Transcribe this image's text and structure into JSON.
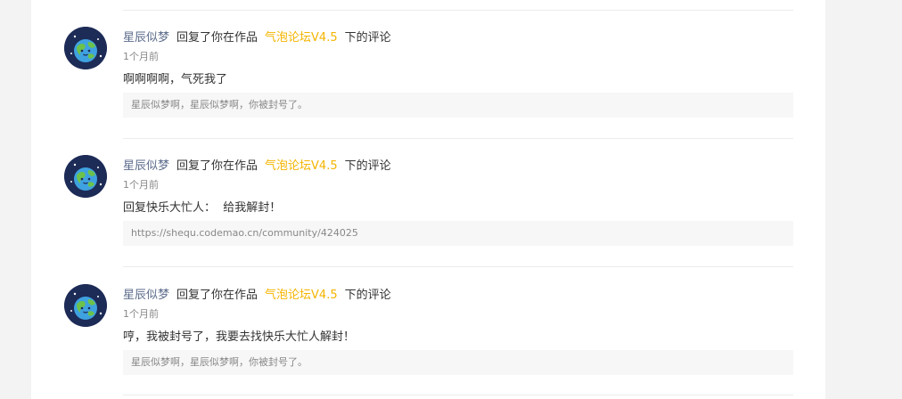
{
  "notifications": [
    {
      "user": "星辰似梦",
      "action_prefix": "回复了你在作品",
      "work_title": "气泡论坛V4.5",
      "action_suffix": "下的评论",
      "time": "1个月前",
      "content": "啊啊啊啊，气死我了",
      "quote": "星辰似梦啊，星辰似梦啊，你被封号了。",
      "avatar_icon": "earth-avatar-icon"
    },
    {
      "user": "星辰似梦",
      "action_prefix": "回复了你在作品",
      "work_title": "气泡论坛V4.5",
      "action_suffix": "下的评论",
      "time": "1个月前",
      "content": "回复快乐大忙人：  给我解封！",
      "quote": "https://shequ.codemao.cn/community/424025",
      "avatar_icon": "earth-avatar-icon"
    },
    {
      "user": "星辰似梦",
      "action_prefix": "回复了你在作品",
      "work_title": "气泡论坛V4.5",
      "action_suffix": "下的评论",
      "time": "1个月前",
      "content": "哼，我被封号了，我要去找快乐大忙人解封！",
      "quote": "星辰似梦啊，星辰似梦啊，你被封号了。",
      "avatar_icon": "earth-avatar-icon"
    }
  ],
  "colors": {
    "username": "#5b6b8a",
    "work_link": "#f4b400",
    "quote_bg": "#f7f7f7"
  }
}
